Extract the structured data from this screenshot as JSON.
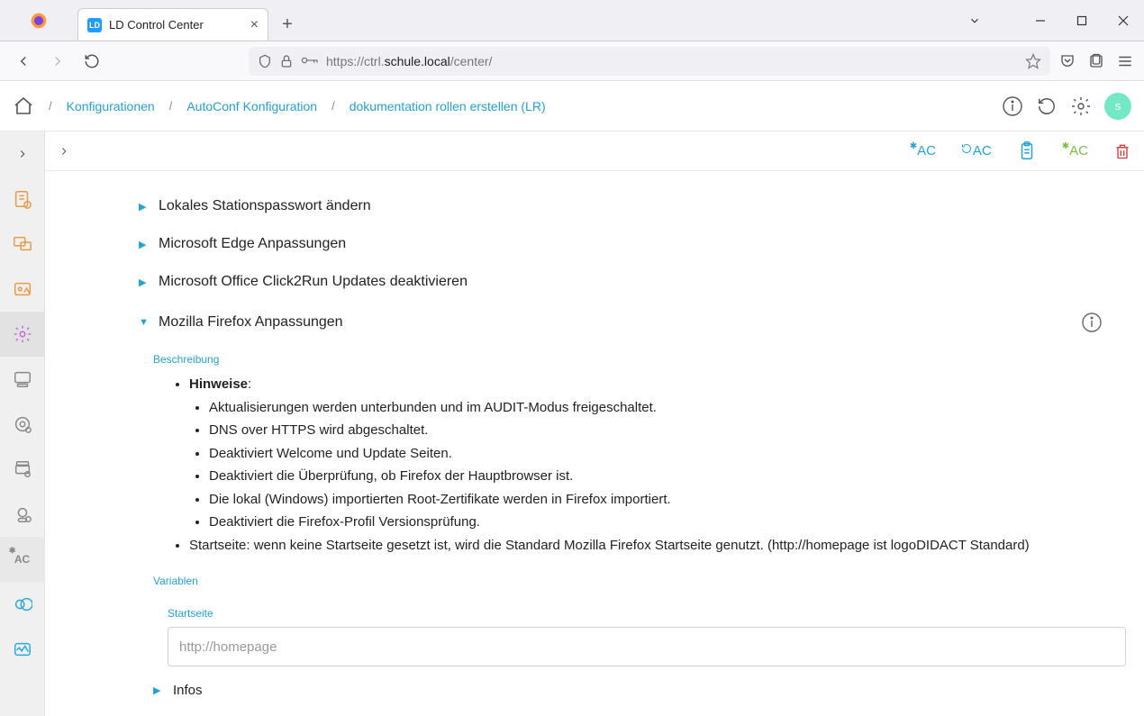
{
  "browser": {
    "tab_title": "LD Control Center",
    "favicon_text": "LD",
    "url_prefix": "https://ctrl.",
    "url_host": "schule.local",
    "url_path": "/center/"
  },
  "breadcrumb": {
    "item1": "Konfigurationen",
    "item2": "AutoConf Konfiguration",
    "item3": "dokumentation rollen erstellen (LR)"
  },
  "avatar_letter": "s",
  "toolbar_actions": {
    "ac1": "AC",
    "ac2": "AC",
    "ac3": "AC"
  },
  "accordion": {
    "item1": "Lokales Stationspasswort ändern",
    "item2": "Microsoft Edge Anpassungen",
    "item3": "Microsoft Office Click2Run Updates deaktivieren",
    "item4": "Mozilla Firefox Anpassungen"
  },
  "section_beschreibung": "Beschreibung",
  "hinweise_label": "Hinweise",
  "hinweise_colon": ":",
  "notes": {
    "n1": "Aktualisierungen werden unterbunden und im AUDIT-Modus freigeschaltet.",
    "n2": "DNS over HTTPS wird abgeschaltet.",
    "n3": "Deaktiviert Welcome und Update Seiten.",
    "n4": "Deaktiviert die Überprüfung, ob Firefox der Hauptbrowser ist.",
    "n5": "Die lokal (Windows) importierten Root-Zertifikate werden in Firefox importiert.",
    "n6": "Deaktiviert die Firefox-Profil Versionsprüfung."
  },
  "startseite_note": "Startseite: wenn keine Startseite gesetzt ist, wird die Standard Mozilla Firefox Startseite genutzt. (http://homepage ist logoDIDACT Standard)",
  "section_variablen": "Variablen",
  "var_startseite_label": "Startseite",
  "var_startseite_placeholder": "http://homepage",
  "infos_label": "Infos"
}
